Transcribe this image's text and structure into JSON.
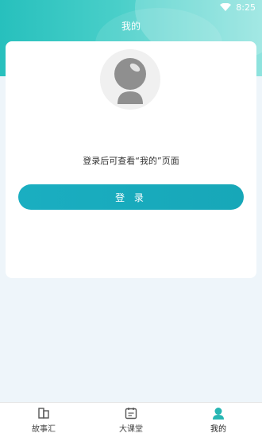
{
  "status_bar": {
    "time": "8:25"
  },
  "header": {
    "title": "我的"
  },
  "profile": {
    "hint": "登录后可查看“我的”页面",
    "login_label": "登 录"
  },
  "tabbar": {
    "items": [
      {
        "label": "故事汇",
        "icon": "book-icon"
      },
      {
        "label": "大课堂",
        "icon": "calendar-icon"
      },
      {
        "label": "我的",
        "icon": "user-icon",
        "active": true
      }
    ]
  },
  "colors": {
    "accent": "#1aaec1",
    "header_start": "#27c0bd",
    "header_end": "#8fe3de",
    "active_tab": "#27b6b3"
  }
}
